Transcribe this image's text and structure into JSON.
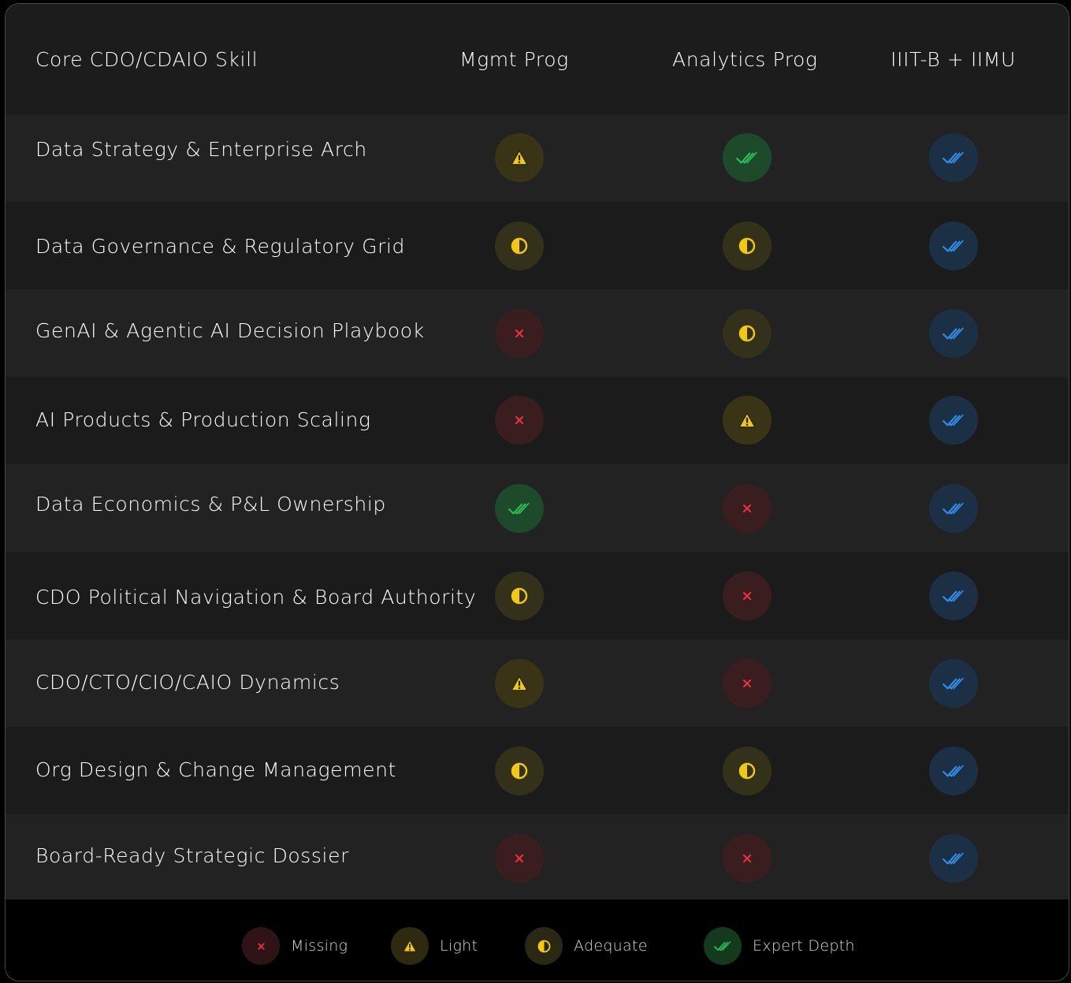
{
  "header": {
    "skill_col": "Core CDO/CDAIO Skill",
    "col1": "Mgmt Prog",
    "col2": "Analytics Prog",
    "col3": "IIIT-B + IIMU"
  },
  "rows": [
    {
      "skill": "Data Strategy & Enterprise Arch",
      "ratings": [
        "light",
        "expert",
        "full"
      ]
    },
    {
      "skill": "Data Governance & Regulatory Grid",
      "ratings": [
        "adequate",
        "adequate",
        "full"
      ]
    },
    {
      "skill": "GenAI & Agentic AI Decision Playbook",
      "ratings": [
        "missing",
        "adequate",
        "full"
      ]
    },
    {
      "skill": "AI Products & Production Scaling",
      "ratings": [
        "missing",
        "light",
        "full"
      ]
    },
    {
      "skill": "Data Economics & P&L Ownership",
      "ratings": [
        "expert",
        "missing",
        "full"
      ]
    },
    {
      "skill": "CDO Political Navigation & Board Authority",
      "ratings": [
        "adequate",
        "missing",
        "full"
      ]
    },
    {
      "skill": "CDO/CTO/CIO/CAIO Dynamics",
      "ratings": [
        "light",
        "missing",
        "full"
      ]
    },
    {
      "skill": "Org Design & Change Management",
      "ratings": [
        "adequate",
        "adequate",
        "full"
      ]
    },
    {
      "skill": "Board-Ready Strategic Dossier",
      "ratings": [
        "missing",
        "missing",
        "full"
      ]
    }
  ],
  "legend": {
    "missing": "Missing",
    "light": "Light",
    "adequate": "Adequate",
    "expert": "Expert Depth"
  },
  "colors": {
    "missing": "#e8323c",
    "light": "#f2c811",
    "adequate": "#f2c811",
    "expert": "#2bbf55",
    "full": "#2f8fe8"
  }
}
